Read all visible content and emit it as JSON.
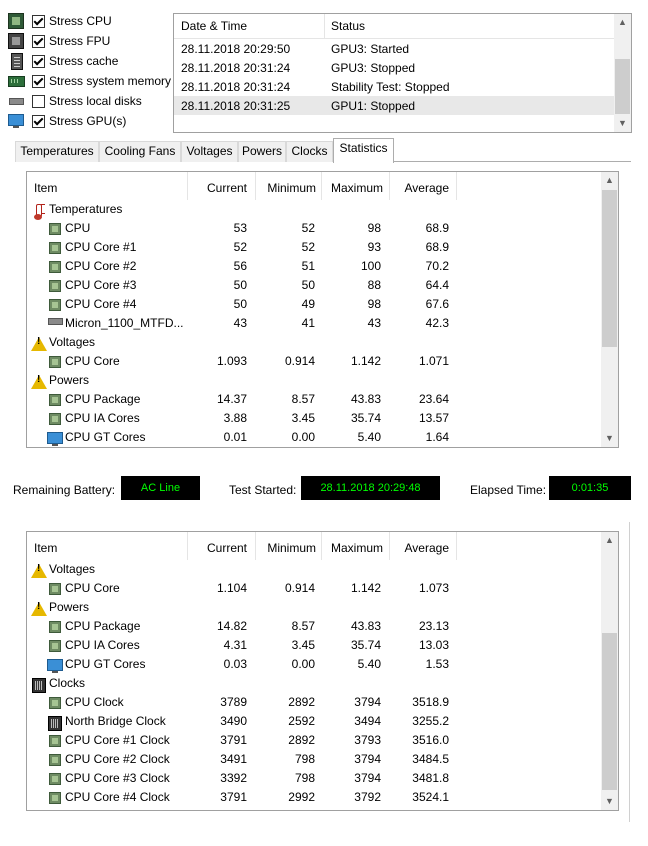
{
  "stress_options": [
    {
      "label": "Stress CPU",
      "checked": true,
      "icon": "cpu-chip-icon"
    },
    {
      "label": "Stress FPU",
      "checked": true,
      "icon": "fpu-icon"
    },
    {
      "label": "Stress cache",
      "checked": true,
      "icon": "cache-icon"
    },
    {
      "label": "Stress system memory",
      "checked": true,
      "icon": "memory-icon"
    },
    {
      "label": "Stress local disks",
      "checked": false,
      "icon": "disk-icon"
    },
    {
      "label": "Stress GPU(s)",
      "checked": true,
      "icon": "gpu-monitor-icon"
    }
  ],
  "log": {
    "columns": [
      "Date & Time",
      "Status"
    ],
    "rows": [
      {
        "datetime": "28.11.2018 20:29:50",
        "status": "GPU3: Started"
      },
      {
        "datetime": "28.11.2018 20:31:24",
        "status": "GPU3: Stopped"
      },
      {
        "datetime": "28.11.2018 20:31:24",
        "status": "Stability Test: Stopped"
      },
      {
        "datetime": "28.11.2018 20:31:25",
        "status": "GPU1: Stopped"
      }
    ]
  },
  "tabs": [
    "Temperatures",
    "Cooling Fans",
    "Voltages",
    "Powers",
    "Clocks",
    "Statistics"
  ],
  "active_tab": "Statistics",
  "grid_columns": [
    "Item",
    "Current",
    "Minimum",
    "Maximum",
    "Average"
  ],
  "grid1_rows": [
    {
      "type": "group",
      "icon": "thermometer-icon",
      "item": "Temperatures"
    },
    {
      "type": "row",
      "icon": "cpu-chip-icon",
      "item": "CPU",
      "current": "53",
      "minimum": "52",
      "maximum": "98",
      "average": "68.9"
    },
    {
      "type": "row",
      "icon": "cpu-chip-icon",
      "item": "CPU Core #1",
      "current": "52",
      "minimum": "52",
      "maximum": "93",
      "average": "68.9"
    },
    {
      "type": "row",
      "icon": "cpu-chip-icon",
      "item": "CPU Core #2",
      "current": "56",
      "minimum": "51",
      "maximum": "100",
      "average": "70.2"
    },
    {
      "type": "row",
      "icon": "cpu-chip-icon",
      "item": "CPU Core #3",
      "current": "50",
      "minimum": "50",
      "maximum": "88",
      "average": "64.4"
    },
    {
      "type": "row",
      "icon": "cpu-chip-icon",
      "item": "CPU Core #4",
      "current": "50",
      "minimum": "49",
      "maximum": "98",
      "average": "67.6"
    },
    {
      "type": "row",
      "icon": "disk-icon",
      "item": "Micron_1100_MTFD...",
      "current": "43",
      "minimum": "41",
      "maximum": "43",
      "average": "42.3"
    },
    {
      "type": "group",
      "icon": "warning-icon",
      "item": "Voltages"
    },
    {
      "type": "row",
      "icon": "cpu-chip-icon",
      "item": "CPU Core",
      "current": "1.093",
      "minimum": "0.914",
      "maximum": "1.142",
      "average": "1.071"
    },
    {
      "type": "group",
      "icon": "warning-icon",
      "item": "Powers"
    },
    {
      "type": "row",
      "icon": "cpu-chip-icon",
      "item": "CPU Package",
      "current": "14.37",
      "minimum": "8.57",
      "maximum": "43.83",
      "average": "23.64"
    },
    {
      "type": "row",
      "icon": "cpu-chip-icon",
      "item": "CPU IA Cores",
      "current": "3.88",
      "minimum": "3.45",
      "maximum": "35.74",
      "average": "13.57"
    },
    {
      "type": "row",
      "icon": "gpu-monitor-icon",
      "item": "CPU GT Cores",
      "current": "0.01",
      "minimum": "0.00",
      "maximum": "5.40",
      "average": "1.64"
    }
  ],
  "status_bar": {
    "battery_label": "Remaining Battery:",
    "battery_value": "AC Line",
    "started_label": "Test Started:",
    "started_value": "28.11.2018 20:29:48",
    "elapsed_label": "Elapsed Time:",
    "elapsed_value": "0:01:35"
  },
  "grid2_rows": [
    {
      "type": "group",
      "icon": "warning-icon",
      "item": "Voltages"
    },
    {
      "type": "row",
      "icon": "cpu-chip-icon",
      "item": "CPU Core",
      "current": "1.104",
      "minimum": "0.914",
      "maximum": "1.142",
      "average": "1.073"
    },
    {
      "type": "group",
      "icon": "warning-icon",
      "item": "Powers"
    },
    {
      "type": "row",
      "icon": "cpu-chip-icon",
      "item": "CPU Package",
      "current": "14.82",
      "minimum": "8.57",
      "maximum": "43.83",
      "average": "23.13"
    },
    {
      "type": "row",
      "icon": "cpu-chip-icon",
      "item": "CPU IA Cores",
      "current": "4.31",
      "minimum": "3.45",
      "maximum": "35.74",
      "average": "13.03"
    },
    {
      "type": "row",
      "icon": "gpu-monitor-icon",
      "item": "CPU GT Cores",
      "current": "0.03",
      "minimum": "0.00",
      "maximum": "5.40",
      "average": "1.53"
    },
    {
      "type": "group",
      "icon": "board-icon",
      "item": "Clocks"
    },
    {
      "type": "row",
      "icon": "cpu-chip-icon",
      "item": "CPU Clock",
      "current": "3789",
      "minimum": "2892",
      "maximum": "3794",
      "average": "3518.9"
    },
    {
      "type": "row",
      "icon": "board-icon",
      "item": "North Bridge Clock",
      "current": "3490",
      "minimum": "2592",
      "maximum": "3494",
      "average": "3255.2"
    },
    {
      "type": "row",
      "icon": "cpu-chip-icon",
      "item": "CPU Core #1 Clock",
      "current": "3791",
      "minimum": "2892",
      "maximum": "3793",
      "average": "3516.0"
    },
    {
      "type": "row",
      "icon": "cpu-chip-icon",
      "item": "CPU Core #2 Clock",
      "current": "3491",
      "minimum": "798",
      "maximum": "3794",
      "average": "3484.5"
    },
    {
      "type": "row",
      "icon": "cpu-chip-icon",
      "item": "CPU Core #3 Clock",
      "current": "3392",
      "minimum": "798",
      "maximum": "3794",
      "average": "3481.8"
    },
    {
      "type": "row",
      "icon": "cpu-chip-icon",
      "item": "CPU Core #4 Clock",
      "current": "3791",
      "minimum": "2992",
      "maximum": "3792",
      "average": "3524.1"
    }
  ],
  "colors": {
    "status_bg": "#000000",
    "status_fg": "#00ff00",
    "selected_row": "#e8e8e8"
  }
}
